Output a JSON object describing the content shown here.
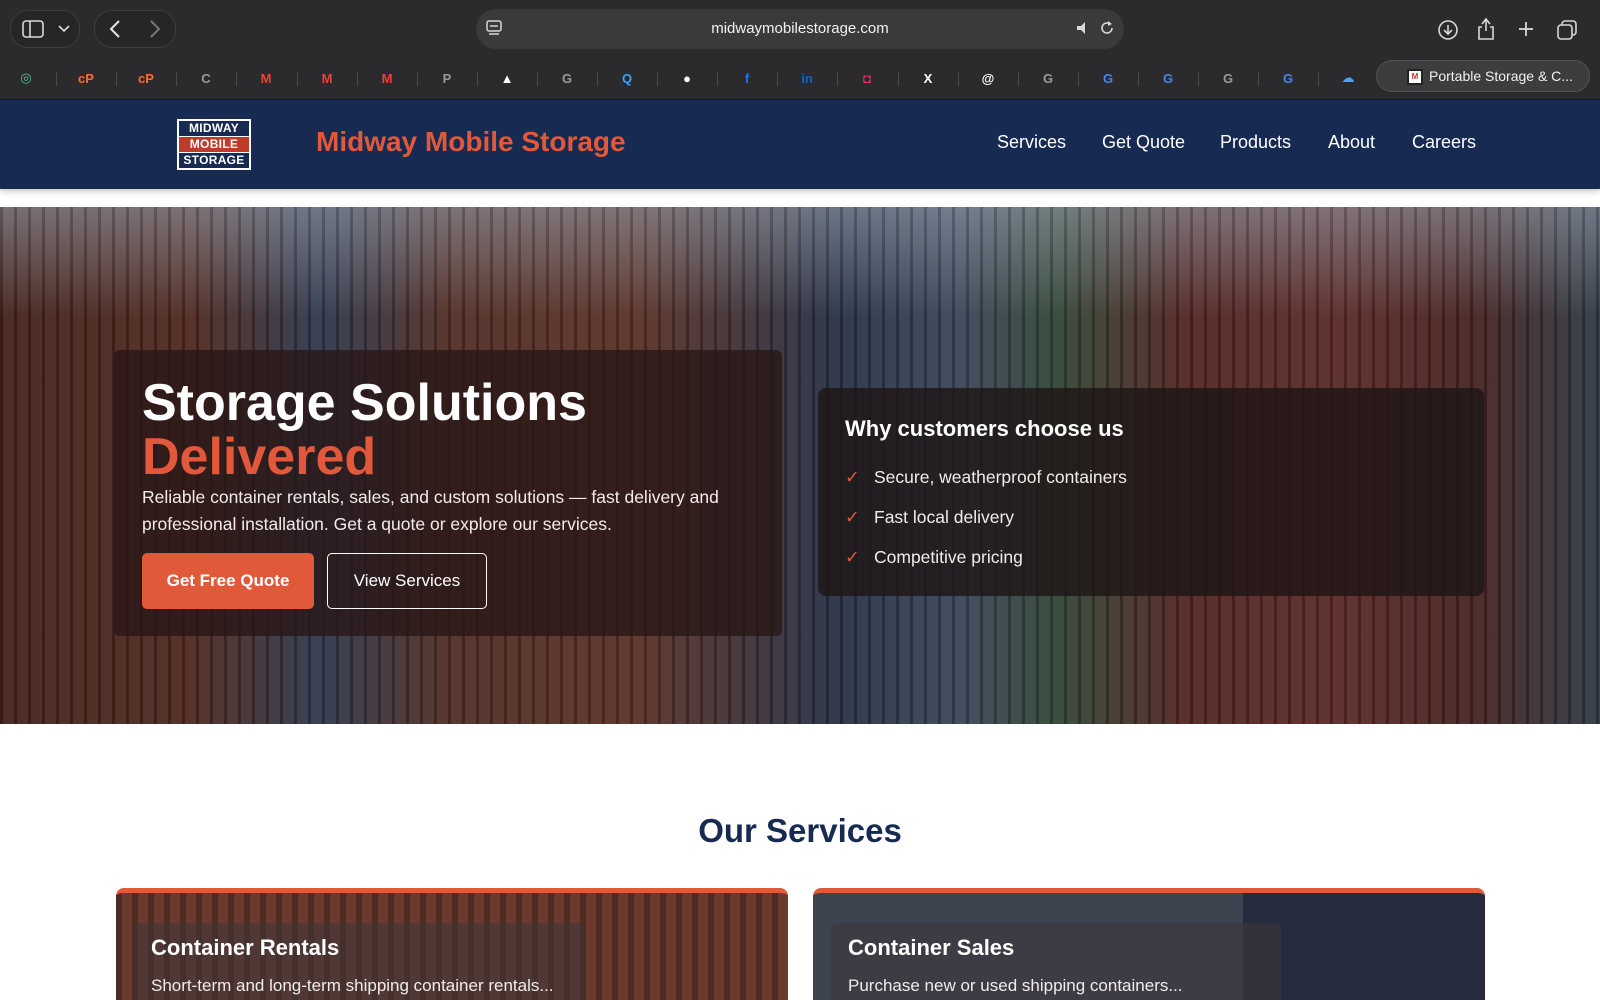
{
  "browser": {
    "url": "midwaymobilestorage.com",
    "bookmarks": [
      {
        "icon": "chatgpt-icon",
        "glyph": "◎",
        "color": "#4fc3a1"
      },
      {
        "icon": "cpanel-icon",
        "glyph": "cP",
        "color": "#ff6c2c"
      },
      {
        "icon": "cpanel-icon",
        "glyph": "cP",
        "color": "#ff6c2c"
      },
      {
        "icon": "letter-c-icon",
        "glyph": "C",
        "color": "#9a9a9e"
      },
      {
        "icon": "gmail-icon",
        "glyph": "M",
        "color": "#ea4335"
      },
      {
        "icon": "gmail-icon",
        "glyph": "M",
        "color": "#ea4335"
      },
      {
        "icon": "gmail-icon",
        "glyph": "M",
        "color": "#ea4335"
      },
      {
        "icon": "letter-p-icon",
        "glyph": "P",
        "color": "#9a9a9e"
      },
      {
        "icon": "triangle-app-icon",
        "glyph": "▲",
        "color": "#ffffff"
      },
      {
        "icon": "letter-g-icon",
        "glyph": "G",
        "color": "#9a9a9e"
      },
      {
        "icon": "magnifier-q-icon",
        "glyph": "Q",
        "color": "#3aa3ff"
      },
      {
        "icon": "github-icon",
        "glyph": "●",
        "color": "#ffffff"
      },
      {
        "icon": "facebook-icon",
        "glyph": "f",
        "color": "#1877f2"
      },
      {
        "icon": "linkedin-icon",
        "glyph": "in",
        "color": "#0a66c2"
      },
      {
        "icon": "instagram-icon",
        "glyph": "◘",
        "color": "#e1306c"
      },
      {
        "icon": "x-icon",
        "glyph": "X",
        "color": "#ffffff"
      },
      {
        "icon": "threads-icon",
        "glyph": "@",
        "color": "#ffffff"
      },
      {
        "icon": "letter-g-icon",
        "glyph": "G",
        "color": "#9a9a9e"
      },
      {
        "icon": "google-icon",
        "glyph": "G",
        "color": "#4285f4"
      },
      {
        "icon": "google-icon",
        "glyph": "G",
        "color": "#4285f4"
      },
      {
        "icon": "letter-g-icon",
        "glyph": "G",
        "color": "#9a9a9e"
      },
      {
        "icon": "google-icon",
        "glyph": "G",
        "color": "#4285f4"
      },
      {
        "icon": "cloud-app-icon",
        "glyph": "☁",
        "color": "#4aa3ff"
      }
    ],
    "active_tab": {
      "label": "Portable Storage & C...",
      "favicon": "M"
    }
  },
  "site": {
    "logo": {
      "line1": "MIDWAY",
      "line2": "MOBILE",
      "line3": "STORAGE"
    },
    "brand": "Midway Mobile Storage",
    "nav": [
      "Services",
      "Get Quote",
      "Products",
      "About",
      "Careers"
    ]
  },
  "hero": {
    "title_line1": "Storage Solutions",
    "title_line2": "Delivered",
    "description": "Reliable container rentals, sales, and custom solutions — fast delivery and professional installation. Get a quote or explore our services.",
    "cta_primary": "Get Free Quote",
    "cta_secondary": "View Services",
    "why": {
      "title": "Why customers choose us",
      "check_glyph": "✓",
      "items": [
        "Secure, weatherproof containers",
        "Fast local delivery",
        "Competitive pricing"
      ]
    }
  },
  "services": {
    "title": "Our Services",
    "cards": [
      {
        "title": "Container Rentals",
        "desc": "Short-term and long-term shipping container rentals..."
      },
      {
        "title": "Container Sales",
        "desc": "Purchase new or used shipping containers..."
      }
    ]
  },
  "colors": {
    "navy": "#172a52",
    "accent": "#e05a3a"
  }
}
